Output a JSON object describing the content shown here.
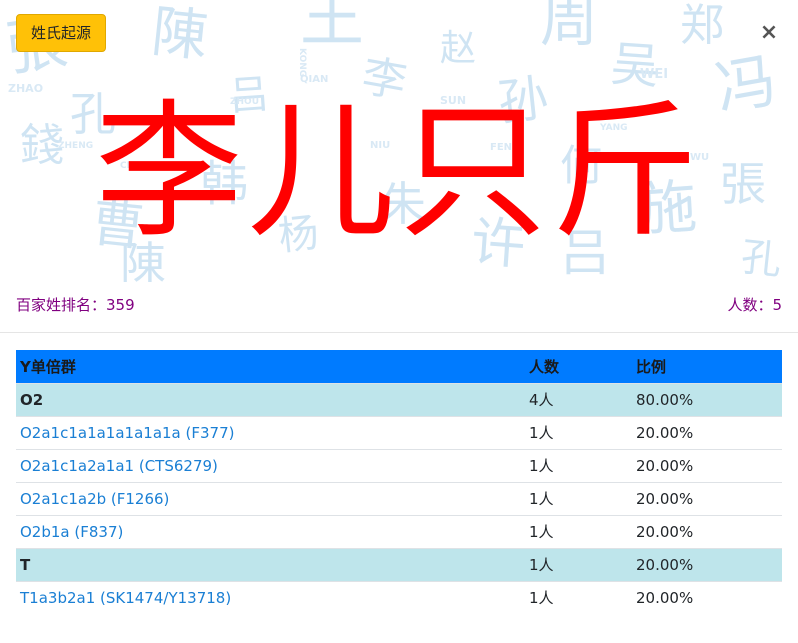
{
  "header": {
    "origin_button": "姓氏起源",
    "close_symbol": "×",
    "surname": "李儿只斤"
  },
  "info": {
    "rank_label": "百家姓排名：",
    "rank_value": "359",
    "count_label": "人数：",
    "count_value": "5"
  },
  "table": {
    "columns": [
      "Y单倍群",
      "人数",
      "比例"
    ],
    "rows": [
      {
        "haplogroup": "O2",
        "count": "4人",
        "percent": "80.00%",
        "group": true
      },
      {
        "haplogroup": "O2a1c1a1a1a1a1a1a (F377)",
        "count": "1人",
        "percent": "20.00%",
        "group": false
      },
      {
        "haplogroup": "O2a1c1a2a1a1 (CTS6279)",
        "count": "1人",
        "percent": "20.00%",
        "group": false
      },
      {
        "haplogroup": "O2a1c1a2b (F1266)",
        "count": "1人",
        "percent": "20.00%",
        "group": false
      },
      {
        "haplogroup": "O2b1a (F837)",
        "count": "1人",
        "percent": "20.00%",
        "group": false
      },
      {
        "haplogroup": "T",
        "count": "1人",
        "percent": "20.00%",
        "group": true
      },
      {
        "haplogroup": "T1a3b2a1 (SK1474/Y13718)",
        "count": "1人",
        "percent": "20.00%",
        "group": false
      }
    ]
  },
  "background": {
    "glyphs": [
      "張",
      "孔",
      "陳",
      "吕",
      "王",
      "李",
      "赵",
      "孙",
      "周",
      "吴",
      "郑",
      "冯",
      "錢",
      "曹",
      "韩",
      "杨",
      "朱",
      "许",
      "何",
      "施"
    ],
    "romanized": [
      "ZHAO",
      "QIAN",
      "SUN",
      "WEI",
      "KONG",
      "NIU",
      "ZHOU",
      "WU",
      "ZHENG",
      "FENG",
      "CHEN",
      "YANG"
    ]
  },
  "colors": {
    "accent": "#007bff",
    "origin_button": "#ffc107",
    "title_red": "#ff0000",
    "group_row": "#bee5eb",
    "link": "#1a7fd4",
    "info_text": "#800080"
  }
}
